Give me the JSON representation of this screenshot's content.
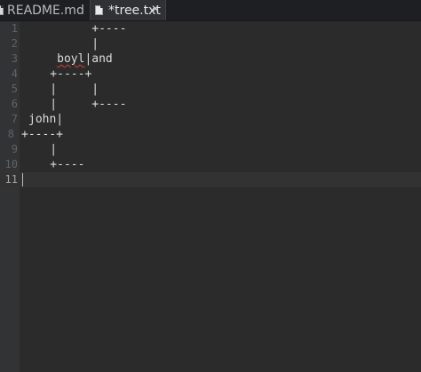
{
  "tabs": [
    {
      "label": "README.md",
      "icon": "file-icon",
      "active": false
    },
    {
      "label": "*tree.txt",
      "icon": "file-icon",
      "active": true,
      "close": "✕"
    }
  ],
  "editor": {
    "lines": [
      {
        "num": "1",
        "text": "          +----"
      },
      {
        "num": "2",
        "text": "          |"
      },
      {
        "num": "3",
        "pre": "     ",
        "squiggle": "boyl",
        "post": "|and"
      },
      {
        "num": "4",
        "text": "    +----+"
      },
      {
        "num": "5",
        "text": "    |     |"
      },
      {
        "num": "6",
        "text": "    |     +----"
      },
      {
        "num": "7",
        "text": "john|"
      },
      {
        "num": "8",
        "text": "+----+"
      },
      {
        "num": "9",
        "text": "    |"
      },
      {
        "num": "10",
        "text": "    +----"
      },
      {
        "num": "11",
        "text": ""
      }
    ],
    "current_line": "11"
  },
  "colors": {
    "background": "#2b2b2b",
    "gutter": "#313335",
    "text": "#dcdcdc",
    "line_number": "#606366",
    "squiggle": "#d04040"
  }
}
